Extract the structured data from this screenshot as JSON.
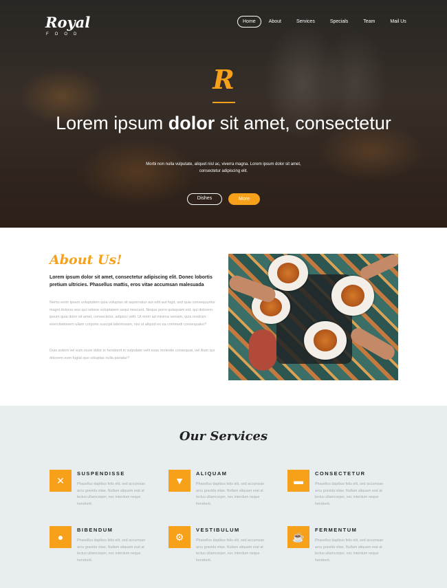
{
  "brand": {
    "name": "Royal",
    "tagline": "FOOD"
  },
  "nav": {
    "items": [
      "Home",
      "About",
      "Services",
      "Specials",
      "Team",
      "Mail Us"
    ],
    "active": "Home"
  },
  "hero": {
    "mark": "R",
    "title_pre": "Lorem ipsum ",
    "title_bold": "dolor",
    "title_post": " sit amet, consectetur",
    "subtitle": "Morbi non nulla vulputate, aliquet nisl ac, viverra magna. Lorem ipsum dolor sit amet, consectetur adipiscing elit.",
    "btn_primary": "Dishes",
    "btn_secondary": "More"
  },
  "about": {
    "title": "About Us!",
    "lead": "Lorem ipsum dolor sit amet, consectetur adipiscing elit. Donec lobortis pretium ultricies. Phasellus mattis, eros vitae accumsan malesuada",
    "p1": "Nemo enim ipsam voluptatem quia voluptas sit aspernatur aut odit aut fugit, sed quia consequuntur magni dolores eos qui ratione voluptatem sequi nesciunt. Neque porro quisquam est, qui dolorem ipsum quia dolor sit amet, consectetur, adipisci velit. Ut enim ad minima veniam, quis nostrum exercitationem ullam corporis suscipit laboriosam, nisi ut aliquid ex ea commodi consequatur?",
    "p2": "Duis autem vel eum iriure dolor in hendrerit in vulputate velit esse molestie consequat, vel illum qui dolorem eum fugiat quo voluptas nulla pariatur?"
  },
  "services": {
    "title": "Our Services",
    "items": [
      {
        "title": "SUSPENDISSE",
        "icon": "cutlery-icon",
        "text": "Phasellus dapibus felis elit, sed accumsan arcu gravida vitae. Nullam aliquam erat at lectus ullamcorper, nec interdum neque hendrerit."
      },
      {
        "title": "ALIQUAM",
        "icon": "cocktail-icon",
        "text": "Phasellus dapibus felis elit, sed accumsan arcu gravida vitae. Nullam aliquam erat at lectus ullamcorper, nec interdum neque hendrerit."
      },
      {
        "title": "CONSECTETUR",
        "icon": "truck-icon",
        "text": "Phasellus dapibus felis elit, sed accumsan arcu gravida vitae. Nullam aliquam erat at lectus ullamcorper, nec interdum neque hendrerit."
      },
      {
        "title": "BIBENDUM",
        "icon": "user-icon",
        "text": "Phasellus dapibus felis elit, sed accumsan arcu gravida vitae. Nullam aliquam erat at lectus ullamcorper, nec interdum neque hendrerit."
      },
      {
        "title": "VESTIBULUM",
        "icon": "gear-icon",
        "text": "Phasellus dapibus felis elit, sed accumsan arcu gravida vitae. Nullam aliquam erat at lectus ullamcorper, nec interdum neque hendrerit."
      },
      {
        "title": "FERMENTUM",
        "icon": "coffee-icon",
        "text": "Phasellus dapibus felis elit, sed accumsan arcu gravida vitae. Nullam aliquam erat at lectus ullamcorper, nec interdum neque hendrerit."
      }
    ]
  },
  "colors": {
    "accent": "#f7a11a",
    "services_bg": "#e8edf0",
    "text_dark": "#222222",
    "text_muted": "#aaaaaa"
  }
}
